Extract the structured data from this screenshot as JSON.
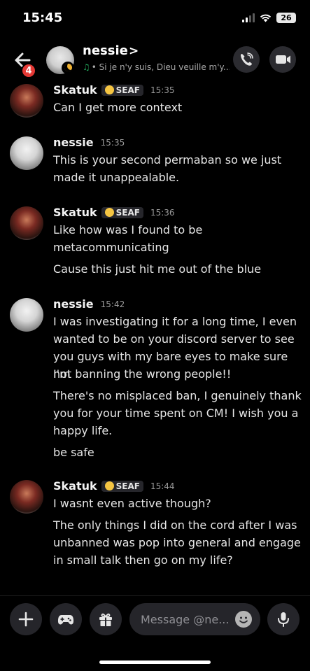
{
  "status_bar": {
    "time": "15:45",
    "battery": "26"
  },
  "header": {
    "back_badge": "4",
    "title": "nessie",
    "chevron": ">",
    "status_note": "♫",
    "status_text": "• Si je n'y suis, Dieu veuille m'y..."
  },
  "messages": [
    {
      "author": "Skatuk",
      "tag": "SEAF",
      "time": "15:35",
      "lines": [
        "Can I get more context"
      ]
    },
    {
      "author": "nessie",
      "time": "15:35",
      "lines": [
        "This is your second permaban so we just",
        "made it unappealable."
      ]
    },
    {
      "author": "Skatuk",
      "tag": "SEAF",
      "time": "15:36",
      "lines": [
        "Like how was I found to be",
        "metacommunicating",
        "Cause this just hit me out of the blue"
      ]
    },
    {
      "author": "nessie",
      "time": "15:42",
      "lines": [
        "I was investigating it for a long time, I even",
        "wanted to be on your discord server to see",
        "you guys with my bare eyes to make sure I'm",
        "not banning the wrong people!!",
        "There's no misplaced ban, I genuinely thank",
        "you for your time spent on CM! I wish you a",
        "happy life.",
        "be safe"
      ]
    },
    {
      "author": "Skatuk",
      "tag": "SEAF",
      "time": "15:44",
      "lines": [
        "I wasnt even active though?",
        "The only things I did on the cord after I was",
        "unbanned was pop into general and engage",
        "in small talk then go on my life?"
      ]
    }
  ],
  "composer": {
    "placeholder": "Message @ne..."
  },
  "colors": {
    "background": "#000000",
    "badge": "#e53935",
    "status_note": "#23a55a",
    "input_bg": "#25252a"
  }
}
